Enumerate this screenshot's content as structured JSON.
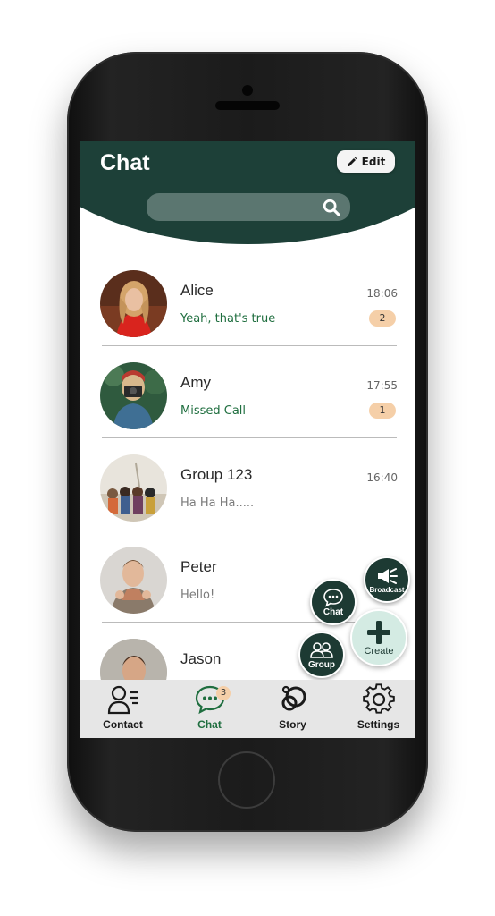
{
  "header": {
    "title": "Chat",
    "edit_label": "Edit"
  },
  "search": {
    "placeholder": ""
  },
  "chats": [
    {
      "name": "Alice",
      "time": "18:06",
      "message": "Yeah, that's true",
      "unread": "2"
    },
    {
      "name": "Amy",
      "time": "17:55",
      "message": "Missed Call",
      "unread": "1"
    },
    {
      "name": "Group 123",
      "time": "16:40",
      "message": "Ha Ha Ha....."
    },
    {
      "name": "Peter",
      "message": "Hello!"
    },
    {
      "name": "Jason"
    }
  ],
  "fab": {
    "broadcast_label": "Broadcast",
    "chat_label": "Chat",
    "group_label": "Group",
    "create_label": "Create"
  },
  "tabs": [
    {
      "label": "Contact",
      "icon": "contact-icon"
    },
    {
      "label": "Chat",
      "icon": "chat-icon",
      "badge": "3",
      "active": true
    },
    {
      "label": "Story",
      "icon": "story-icon"
    },
    {
      "label": "Settings",
      "icon": "gear-icon"
    }
  ],
  "colors": {
    "header": "#1d4038",
    "accent_text": "#1f6e3f",
    "badge": "#f5cfa8",
    "fab_dark": "#1d3a33",
    "fab_create": "#d4ebe3",
    "tab_bar": "#e6e6e6"
  }
}
